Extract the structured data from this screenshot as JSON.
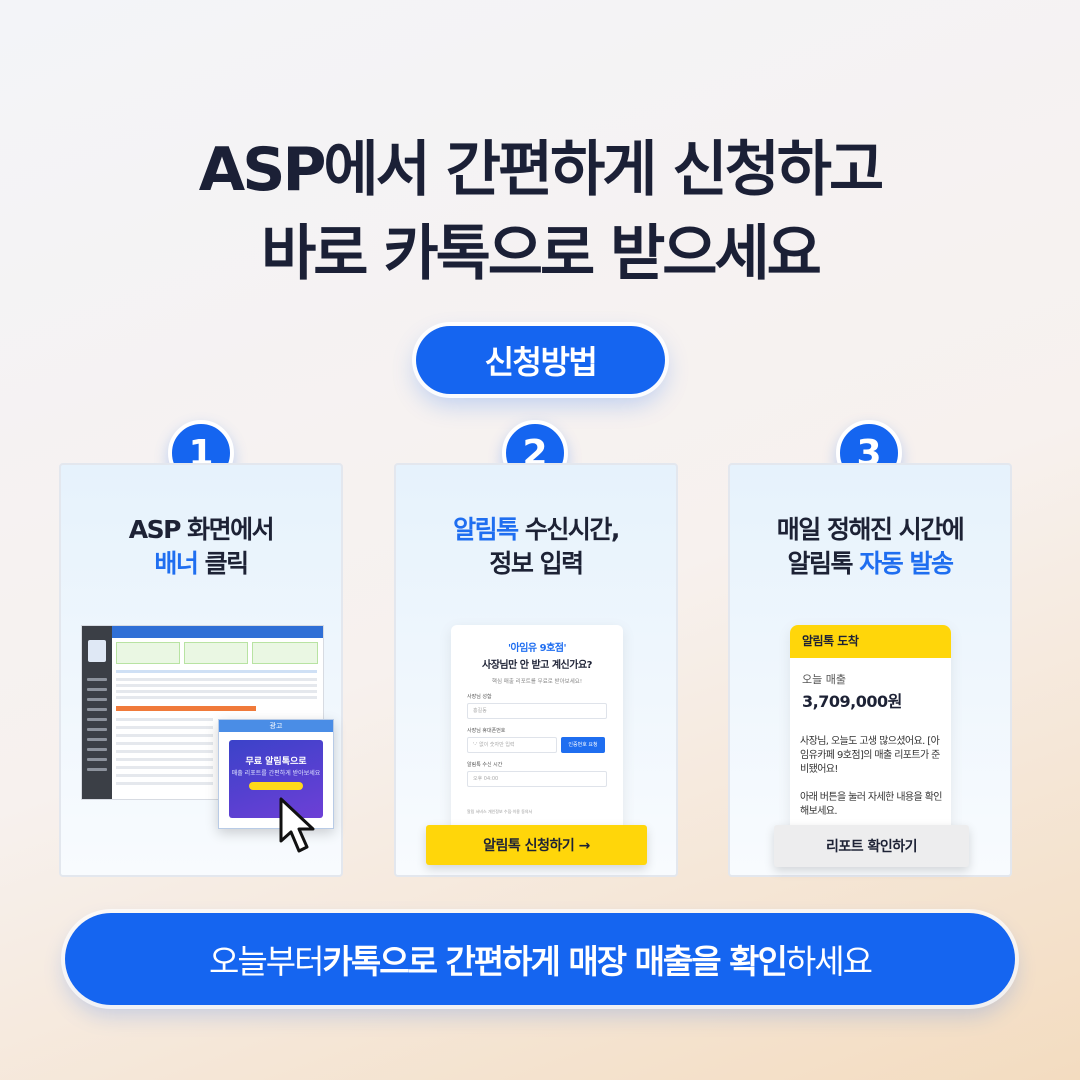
{
  "headline": {
    "line1": "ASP에서 간편하게 신청하고",
    "line2": "바로 카톡으로 받으세요"
  },
  "method_label": "신청방법",
  "steps": [
    {
      "number": "1",
      "title_line1": "ASP 화면에서",
      "title_line2_highlight": "배너",
      "title_line2_rest": " 클릭",
      "banner_popup_label": "광고",
      "banner_text": "무료 알림톡으로",
      "banner_sub": "매출 리포트를 간편하게 받아보세요"
    },
    {
      "number": "2",
      "title_line1_highlight": "알림톡",
      "title_line1_rest": " 수신시간,",
      "title_line2": "정보 입력",
      "form": {
        "brand": "'아임유 9호점'",
        "question": "사장님만 안 받고 계신가요?",
        "sub": "핵심 매출 리포트를 무료로 받아보세요!",
        "name_label": "사장님 성함",
        "name_placeholder": "홍길동",
        "phone_label": "사장님 휴대폰번호",
        "phone_placeholder": "'-' 없이 숫자만 입력",
        "verify_button": "인증번호 요청",
        "time_label": "알림톡 수신 시간",
        "time_value": "오후 04:00",
        "note": "알림 서비스 개인정보 수집·이용 동의서"
      },
      "cta": "알림톡 신청하기 →"
    },
    {
      "number": "3",
      "title_line1": "매일 정해진 시간에",
      "title_line2_plain": "알림톡 ",
      "title_line2_highlight": "자동 발송",
      "message": {
        "header": "알림톡 도착",
        "sales_label": "오늘 매출",
        "sales_amount": "3,709,000원",
        "body1": "사장님, 오늘도 고생 많으셨어요. [아임유카페 9호점]의 매출 리포트가 준비됐어요!",
        "body2": "아래 버튼을 눌러 자세한 내용을 확인해보세요."
      },
      "report_button": "리포트 확인하기"
    }
  ],
  "footer": {
    "prefix": "오늘부터 ",
    "bold": "카톡으로 간편하게 매장 매출을 확인",
    "suffix": "하세요"
  }
}
